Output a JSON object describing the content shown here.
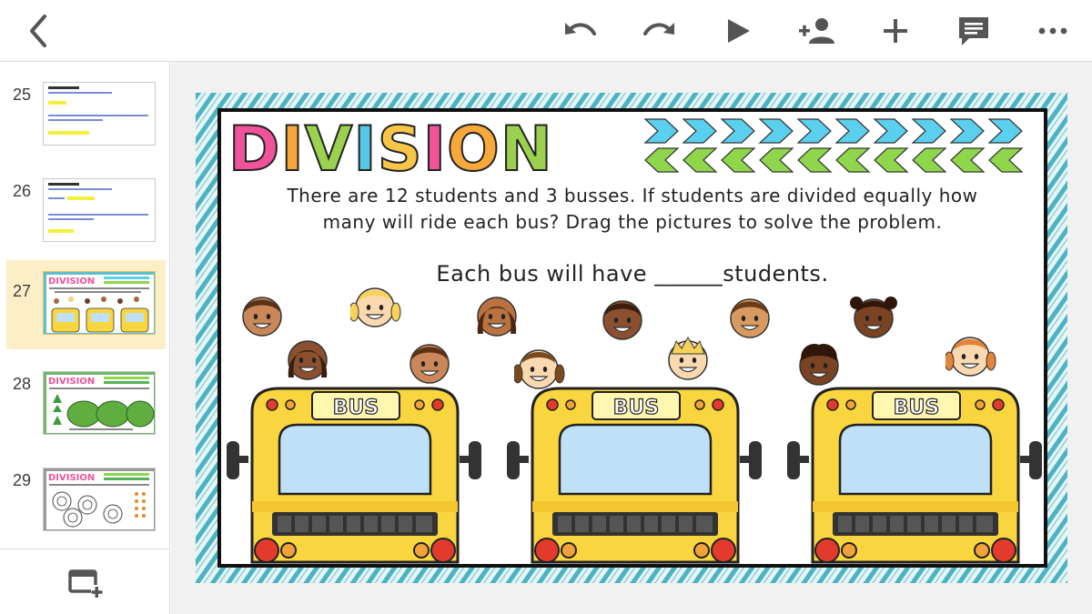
{
  "toolbar": {
    "back_icon": "arrow-back-icon",
    "undo_icon": "undo-icon",
    "redo_icon": "redo-icon",
    "present_icon": "play-icon",
    "share_icon": "add-person-icon",
    "insert_icon": "plus-icon",
    "comment_icon": "comment-icon",
    "more_icon": "more-horizontal-icon"
  },
  "sidebar": {
    "slides": [
      {
        "number": "25",
        "selected": false
      },
      {
        "number": "26",
        "selected": false
      },
      {
        "number": "27",
        "selected": true
      },
      {
        "number": "28",
        "selected": false
      },
      {
        "number": "29",
        "selected": false
      }
    ],
    "new_slide_icon": "new-slide-icon"
  },
  "slide": {
    "title_letters": [
      "D",
      "I",
      "V",
      "I",
      "S",
      "I",
      "O",
      "N"
    ],
    "title_colors": [
      "#f0539a",
      "#f7a83b",
      "#9bd14f",
      "#55c8e6",
      "#f7c548",
      "#f0539a",
      "#f7a83b",
      "#9bd14f"
    ],
    "problem_line1": "There are 12 students and 3 busses. If students are divided equally how",
    "problem_line2": "many will ride each bus? Drag the pictures to solve the problem.",
    "answer_prefix": "Each bus will have ",
    "answer_blank": "______",
    "answer_suffix": "students.",
    "bus_label": "BUS",
    "colors": {
      "bus_yellow": "#f9d63f",
      "window_blue": "#bfe1f7",
      "border_teal": "#4bb3c2",
      "arrow_blue": "#5ad0ee",
      "arrow_green": "#8fd64c"
    }
  }
}
